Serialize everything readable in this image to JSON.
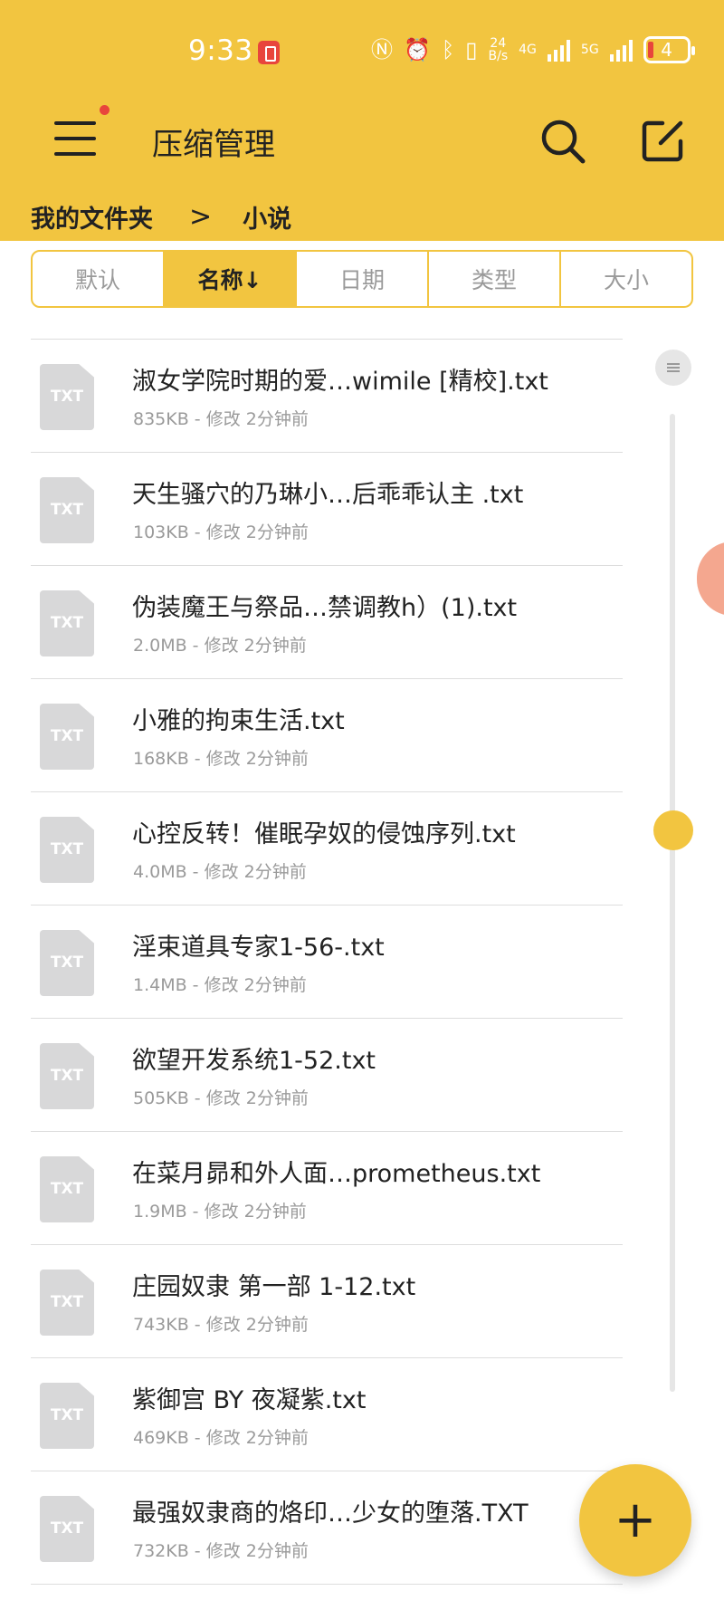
{
  "status_bar": {
    "time": "9:33",
    "net_speed_value": "24",
    "net_speed_unit": "B/s",
    "net1": "4G",
    "net2": "5G",
    "battery": "4"
  },
  "header": {
    "title": "压缩管理",
    "menu_icon": "menu-icon",
    "search_icon": "search-icon",
    "edit_icon": "edit-icon"
  },
  "breadcrumb": {
    "root": "我的文件夹",
    "separator": ">",
    "current": "小说"
  },
  "sort_tabs": [
    {
      "label": "默认",
      "active": false
    },
    {
      "label": "名称↓",
      "active": true
    },
    {
      "label": "日期",
      "active": false
    },
    {
      "label": "类型",
      "active": false
    },
    {
      "label": "大小",
      "active": false
    }
  ],
  "files": [
    {
      "icon": "TXT",
      "name": "淑女学院时期的爱…wimile [精校].txt",
      "meta": "835KB - 修改 2分钟前"
    },
    {
      "icon": "TXT",
      "name": "天生骚穴的乃琳小…后乖乖认主 .txt",
      "meta": "103KB - 修改 2分钟前"
    },
    {
      "icon": "TXT",
      "name": "伪装魔王与祭品…禁调教h）(1).txt",
      "meta": "2.0MB - 修改 2分钟前"
    },
    {
      "icon": "TXT",
      "name": "小雅的拘束生活.txt",
      "meta": "168KB - 修改 2分钟前"
    },
    {
      "icon": "TXT",
      "name": "心控反转！催眠孕奴的侵蚀序列.txt",
      "meta": "4.0MB - 修改 2分钟前"
    },
    {
      "icon": "TXT",
      "name": "淫束道具专家1-56-.txt",
      "meta": "1.4MB - 修改 2分钟前"
    },
    {
      "icon": "TXT",
      "name": "欲望开发系统1-52.txt",
      "meta": "505KB - 修改 2分钟前"
    },
    {
      "icon": "TXT",
      "name": "在菜月昴和外人面…prometheus.txt",
      "meta": "1.9MB - 修改 2分钟前"
    },
    {
      "icon": "TXT",
      "name": "庄园奴隶 第一部 1-12.txt",
      "meta": "743KB - 修改 2分钟前"
    },
    {
      "icon": "TXT",
      "name": "紫御宫 BY 夜凝紫.txt",
      "meta": "469KB - 修改 2分钟前"
    },
    {
      "icon": "TXT",
      "name": "最强奴隶商的烙印…少女的堕落.TXT",
      "meta": "732KB - 修改 2分钟前"
    }
  ],
  "fab": {
    "label": "+"
  },
  "colors": {
    "accent": "#F2C540",
    "text": "#222222",
    "muted": "#9A9A9A",
    "badge": "#E8453C"
  }
}
